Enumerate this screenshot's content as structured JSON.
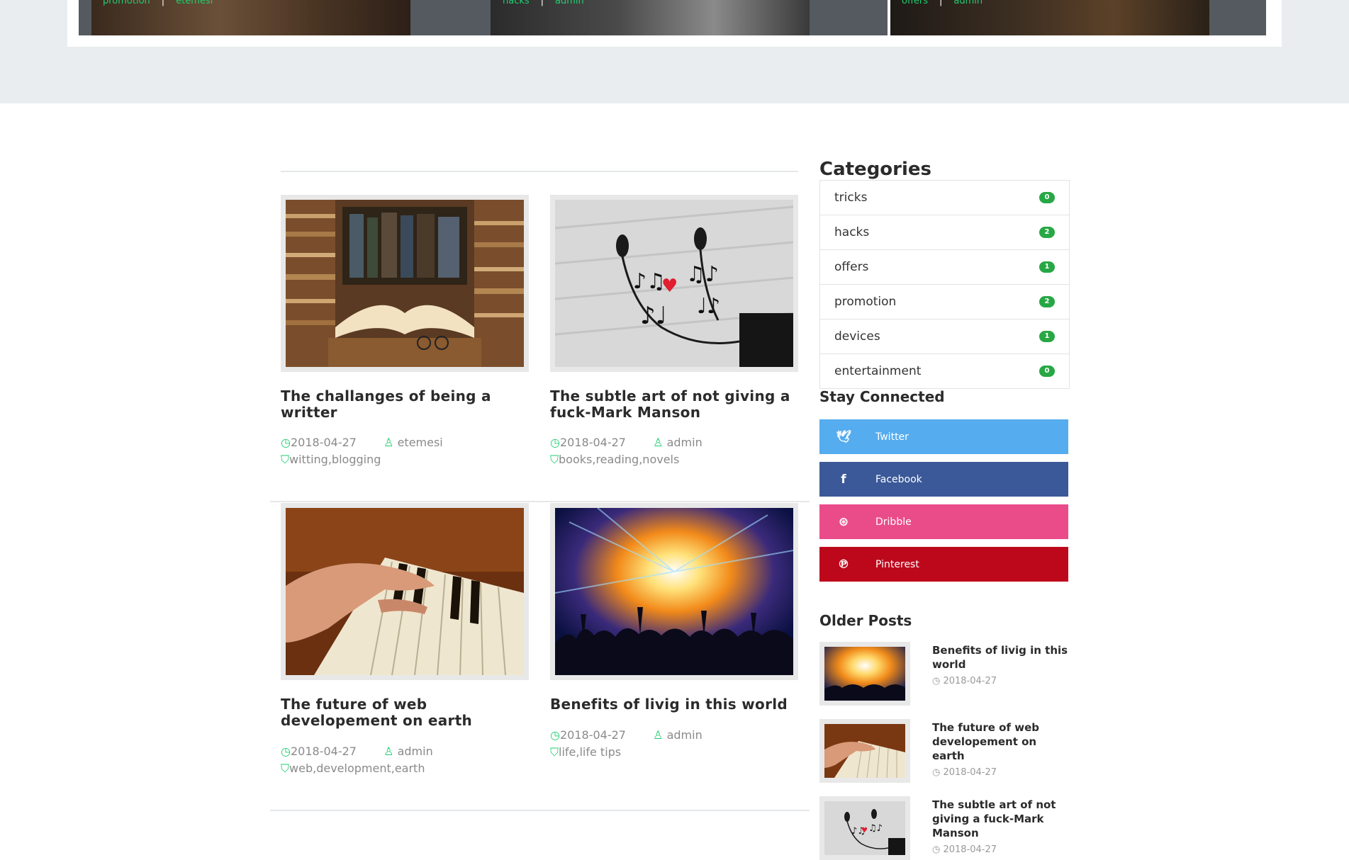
{
  "slider": {
    "slides": [
      {
        "category": "promotion",
        "author": "etemesi",
        "separator": "|"
      },
      {
        "category": "hacks",
        "author": "admin",
        "separator": "|"
      },
      {
        "category": "offers",
        "author": "admin",
        "separator": "|"
      }
    ]
  },
  "posts": [
    {
      "title": "The challanges of being a writter",
      "date": "2018-04-27",
      "author": "etemesi",
      "tags": "witting,blogging",
      "image": "books-photo"
    },
    {
      "title": "The subtle art of not giving a fuck-Mark Manson",
      "date": "2018-04-27",
      "author": "admin",
      "tags": "books,reading,novels",
      "image": "earphones-music-photo"
    },
    {
      "title": "The future of web developement on earth",
      "date": "2018-04-27",
      "author": "admin",
      "tags": "web,development,earth",
      "image": "piano-photo"
    },
    {
      "title": "Benefits of livig in this world",
      "date": "2018-04-27",
      "author": "admin",
      "tags": "life,life tips",
      "image": "concert-photo"
    }
  ],
  "sidebar": {
    "categories_heading": "Categories",
    "categories": [
      {
        "name": "tricks",
        "count": "0"
      },
      {
        "name": "hacks",
        "count": "2"
      },
      {
        "name": "offers",
        "count": "1"
      },
      {
        "name": "promotion",
        "count": "2"
      },
      {
        "name": "devices",
        "count": "1"
      },
      {
        "name": "entertainment",
        "count": "0"
      }
    ],
    "stay_connected_heading": "Stay Connected",
    "social": [
      {
        "label": "Twitter",
        "icon": "twitter-icon",
        "color": "#55acee"
      },
      {
        "label": "Facebook",
        "icon": "facebook-icon",
        "color": "#3b5998"
      },
      {
        "label": "Dribble",
        "icon": "dribbble-icon",
        "color": "#ea4c89"
      },
      {
        "label": "Pinterest",
        "icon": "pinterest-icon",
        "color": "#bd081c"
      }
    ],
    "older_posts_heading": "Older Posts",
    "older_posts": [
      {
        "title": "Benefits of livig in this world",
        "date": "2018-04-27",
        "image": "concert-photo"
      },
      {
        "title": "The future of web developement on earth",
        "date": "2018-04-27",
        "image": "piano-photo"
      },
      {
        "title": "The subtle art of not giving a fuck-Mark Manson",
        "date": "2018-04-27",
        "image": "earphones-music-photo"
      }
    ]
  },
  "colors": {
    "accent": "#1ecf6f",
    "badge": "#28a745",
    "band": "#eaedf0"
  }
}
